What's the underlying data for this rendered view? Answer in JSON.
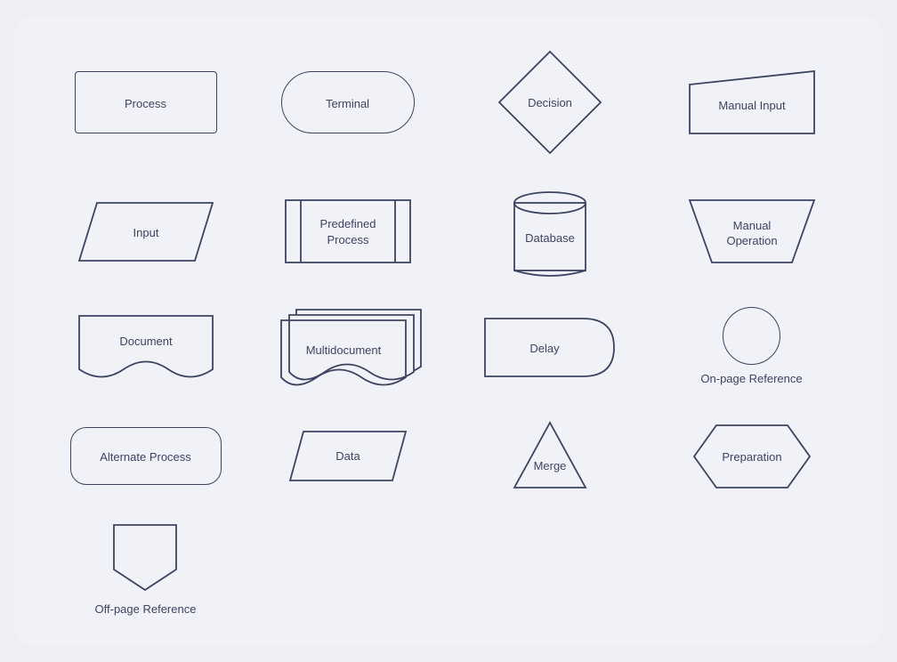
{
  "shapes": [
    {
      "id": "process",
      "label": "Process"
    },
    {
      "id": "terminal",
      "label": "Terminal"
    },
    {
      "id": "decision",
      "label": "Decision"
    },
    {
      "id": "manual-input",
      "label": "Manual Input"
    },
    {
      "id": "input",
      "label": "Input"
    },
    {
      "id": "predefined-process",
      "label": "Predefined\nProcess"
    },
    {
      "id": "database",
      "label": "Database"
    },
    {
      "id": "manual-operation",
      "label": "Manual\nOperation"
    },
    {
      "id": "document",
      "label": "Document"
    },
    {
      "id": "multidocument",
      "label": "Multidocument"
    },
    {
      "id": "delay",
      "label": "Delay"
    },
    {
      "id": "onpage-reference",
      "label": "On-page Reference"
    },
    {
      "id": "alternate-process",
      "label": "Alternate Process"
    },
    {
      "id": "data",
      "label": "Data"
    },
    {
      "id": "merge",
      "label": "Merge"
    },
    {
      "id": "preparation",
      "label": "Preparation"
    },
    {
      "id": "offpage-reference",
      "label": "Off-page Reference"
    }
  ],
  "stroke_color": "#3d4461",
  "stroke_width": "1.8"
}
